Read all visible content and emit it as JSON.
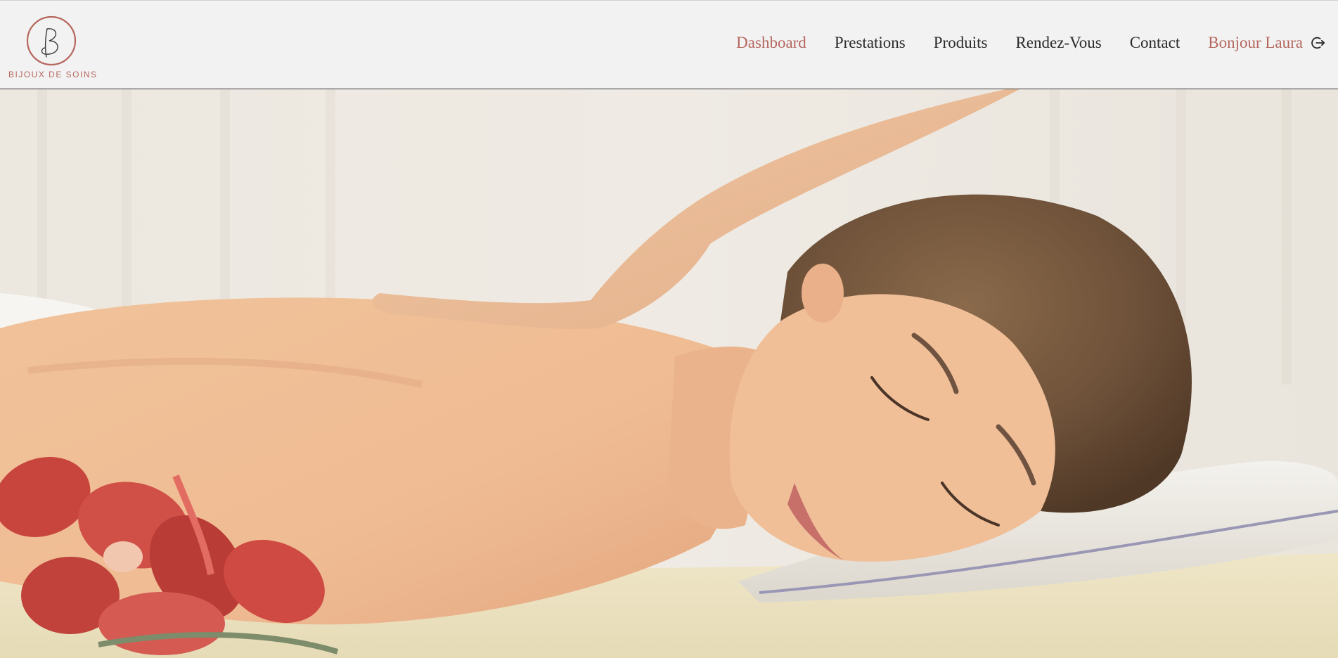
{
  "brand": {
    "logo_letter": "B",
    "name": "BIJOUX DE SOINS",
    "color": "#b5675e"
  },
  "nav": {
    "items": [
      {
        "label": "Dashboard",
        "active": true
      },
      {
        "label": "Prestations",
        "active": false
      },
      {
        "label": "Produits",
        "active": false
      },
      {
        "label": "Rendez-Vous",
        "active": false
      },
      {
        "label": "Contact",
        "active": false
      }
    ],
    "greeting": "Bonjour Laura",
    "logout_icon": "logout-icon"
  },
  "hero": {
    "image": "massage-photo"
  }
}
